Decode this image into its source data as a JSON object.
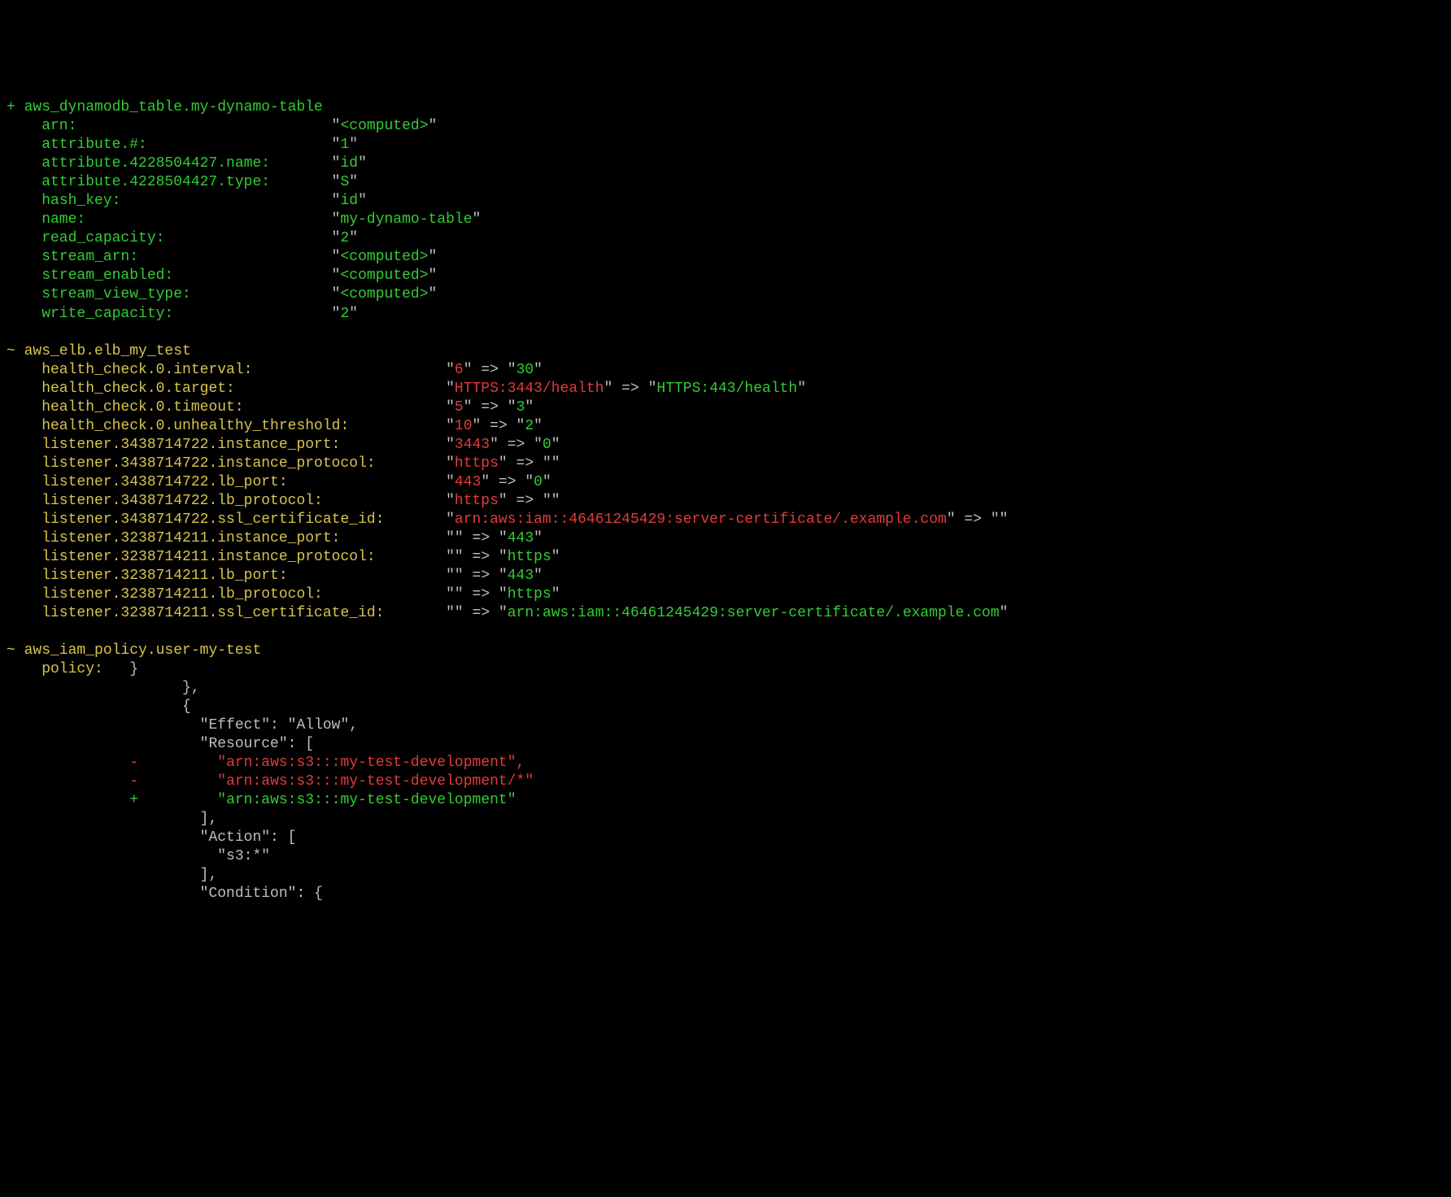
{
  "symbols": {
    "plus": "+",
    "tilde": "~",
    "minus": "-",
    "arrow": "=>",
    "q": "\""
  },
  "blocks": [
    {
      "kind": "create",
      "marker": "+",
      "resource": "aws_dynamodb_table.my-dynamo-table",
      "key_col": 33,
      "attributes": [
        {
          "key": "arn",
          "value": "<computed>"
        },
        {
          "key": "attribute.#",
          "value": "1"
        },
        {
          "key": "attribute.4228504427.name",
          "value": "id"
        },
        {
          "key": "attribute.4228504427.type",
          "value": "S"
        },
        {
          "key": "hash_key",
          "value": "id"
        },
        {
          "key": "name",
          "value": "my-dynamo-table"
        },
        {
          "key": "read_capacity",
          "value": "2"
        },
        {
          "key": "stream_arn",
          "value": "<computed>"
        },
        {
          "key": "stream_enabled",
          "value": "<computed>"
        },
        {
          "key": "stream_view_type",
          "value": "<computed>"
        },
        {
          "key": "write_capacity",
          "value": "2"
        }
      ]
    },
    {
      "kind": "update",
      "marker": "~",
      "resource": "aws_elb.elb_my_test",
      "key_col": 46,
      "attributes": [
        {
          "key": "health_check.0.interval",
          "old": "6",
          "new": "30"
        },
        {
          "key": "health_check.0.target",
          "old": "HTTPS:3443/health",
          "new": "HTTPS:443/health"
        },
        {
          "key": "health_check.0.timeout",
          "old": "5",
          "new": "3"
        },
        {
          "key": "health_check.0.unhealthy_threshold",
          "old": "10",
          "new": "2"
        },
        {
          "key": "listener.3438714722.instance_port",
          "old": "3443",
          "new": "0"
        },
        {
          "key": "listener.3438714722.instance_protocol",
          "old": "https",
          "new": ""
        },
        {
          "key": "listener.3438714722.lb_port",
          "old": "443",
          "new": "0"
        },
        {
          "key": "listener.3438714722.lb_protocol",
          "old": "https",
          "new": ""
        },
        {
          "key": "listener.3438714722.ssl_certificate_id",
          "old": "arn:aws:iam::46461245429:server-certificate/.example.com",
          "new": ""
        },
        {
          "key": "listener.3238714211.instance_port",
          "old": "",
          "new": "443"
        },
        {
          "key": "listener.3238714211.instance_protocol",
          "old": "",
          "new": "https"
        },
        {
          "key": "listener.3238714211.lb_port",
          "old": "",
          "new": "443"
        },
        {
          "key": "listener.3238714211.lb_protocol",
          "old": "",
          "new": "https"
        },
        {
          "key": "listener.3238714211.ssl_certificate_id",
          "old": "",
          "new": "arn:aws:iam::46461245429:server-certificate/.example.com"
        }
      ]
    },
    {
      "kind": "update_diff",
      "marker": "~",
      "resource": "aws_iam_policy.user-my-test",
      "header_attr": "policy",
      "lines": [
        {
          "t": "ctx",
          "indent": 4,
          "first": true,
          "text": "}"
        },
        {
          "t": "ctx",
          "indent": 20,
          "text": "},"
        },
        {
          "t": "ctx",
          "indent": 20,
          "text": "{"
        },
        {
          "t": "ctx",
          "indent": 22,
          "text": "\"Effect\": \"Allow\","
        },
        {
          "t": "ctx",
          "indent": 22,
          "text": "\"Resource\": ["
        },
        {
          "t": "minus",
          "indent": 24,
          "text": "\"arn:aws:s3:::my-test-development\","
        },
        {
          "t": "minus",
          "indent": 24,
          "text": "\"arn:aws:s3:::my-test-development/*\""
        },
        {
          "t": "plus",
          "indent": 24,
          "text": "\"arn:aws:s3:::my-test-development\""
        },
        {
          "t": "ctx",
          "indent": 22,
          "text": "],"
        },
        {
          "t": "ctx",
          "indent": 22,
          "text": "\"Action\": ["
        },
        {
          "t": "ctx",
          "indent": 24,
          "text": "\"s3:*\""
        },
        {
          "t": "ctx",
          "indent": 22,
          "text": "],"
        },
        {
          "t": "ctx",
          "indent": 22,
          "text": "\"Condition\": {"
        }
      ]
    }
  ]
}
